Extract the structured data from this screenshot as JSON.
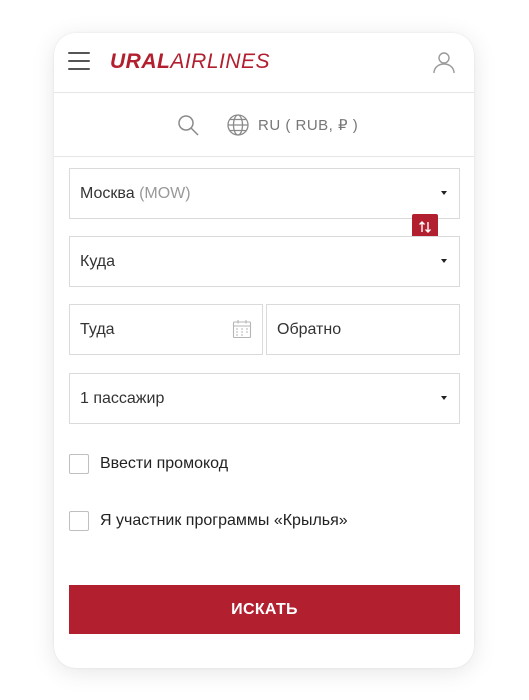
{
  "header": {
    "logo_bold": "URAL",
    "logo_thin": "AIRLINES"
  },
  "locale": {
    "label": "RU ( RUB, ₽ )"
  },
  "form": {
    "origin": {
      "city": "Москва",
      "code": "(MOW)"
    },
    "destination": {
      "placeholder": "Куда"
    },
    "depart": {
      "placeholder": "Туда"
    },
    "return": {
      "placeholder": "Обратно"
    },
    "passengers": {
      "value": "1 пассажир"
    },
    "promo_label": "Ввести промокод",
    "wings_label": "Я участник программы «Крылья»",
    "submit_label": "ИСКАТЬ"
  },
  "colors": {
    "brand": "#b22030",
    "border": "#dadada",
    "muted": "#999999"
  }
}
